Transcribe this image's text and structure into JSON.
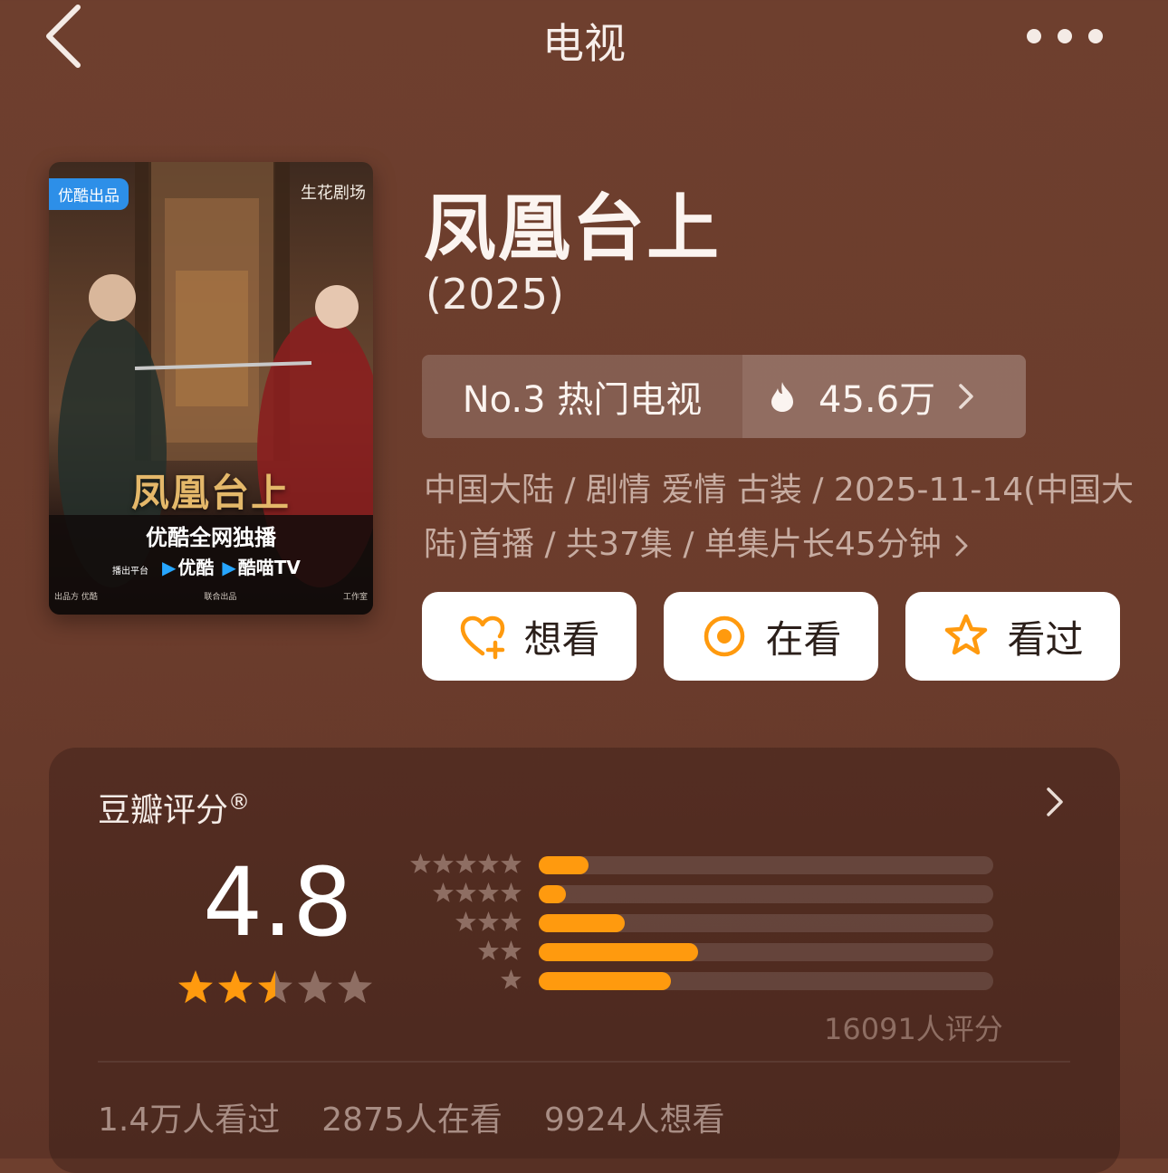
{
  "nav": {
    "title": "电视"
  },
  "poster": {
    "badge": "优酷出品",
    "studio": "生花剧场",
    "title": "凤凰台上",
    "tagline": "优酷全网独播",
    "platform_label": "播出平台",
    "platform_1": "优酷",
    "platform_2": "酷喵TV",
    "footer_left": "出品方 优酷",
    "footer_mid": "联合出品",
    "footer_right": "工作室"
  },
  "show": {
    "title": "凤凰台上",
    "year": "(2025)"
  },
  "rank": {
    "label": "No.3 热门电视",
    "heat": "45.6万"
  },
  "meta": {
    "text": "中国大陆 / 剧情 爱情 古装 / 2025-11-14(中国大陆)首播 / 共37集 / 单集片长45分钟"
  },
  "actions": {
    "want": "想看",
    "watching": "在看",
    "watched": "看过"
  },
  "rating": {
    "label": "豆瓣评分",
    "reg": "®",
    "score": "4.8",
    "stars": 2.5,
    "distribution": [
      {
        "stars": 5,
        "fraction": 0.11
      },
      {
        "stars": 4,
        "fraction": 0.06
      },
      {
        "stars": 3,
        "fraction": 0.19
      },
      {
        "stars": 2,
        "fraction": 0.35
      },
      {
        "stars": 1,
        "fraction": 0.29
      }
    ],
    "count": "16091人评分"
  },
  "stats": {
    "watched": "1.4万人看过",
    "watching": "2875人在看",
    "want": "9924人想看"
  },
  "colors": {
    "accent": "#ff9a0e",
    "background": "#6e3f2e"
  }
}
